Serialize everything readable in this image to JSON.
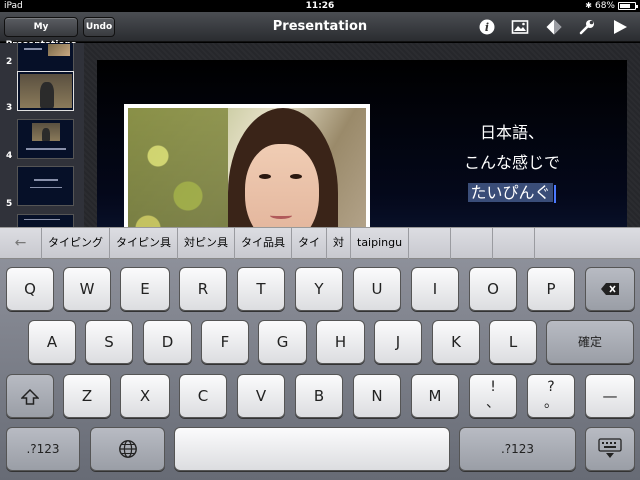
{
  "status": {
    "device": "iPad",
    "time": "11:26",
    "battery_text": "68%",
    "battery_level": 0.68
  },
  "toolbar": {
    "my_presentations": "My Presentations",
    "undo": "Undo",
    "title": "Presentation"
  },
  "navigator": {
    "slide_numbers": [
      "2",
      "3",
      "4",
      "5"
    ]
  },
  "slide": {
    "text_line1": "日本語、",
    "text_line2": "こんな感じで",
    "text_line3": "たいぴんぐ"
  },
  "candidates": [
    "タイピング",
    "タイピン具",
    "対ピン具",
    "タイ品具",
    "タイ",
    "対",
    "taipingu"
  ],
  "keyboard": {
    "row1": [
      "Q",
      "W",
      "E",
      "R",
      "T",
      "Y",
      "U",
      "I",
      "O",
      "P"
    ],
    "row2": [
      "A",
      "S",
      "D",
      "F",
      "G",
      "H",
      "J",
      "K",
      "L"
    ],
    "row3": [
      "Z",
      "X",
      "C",
      "V",
      "B",
      "N",
      "M"
    ],
    "confirm": "確定",
    "exclam_top": "!",
    "exclam_bottom": "、",
    "question_top": "?",
    "question_bottom": "。",
    "dash": "—",
    "num_left": ".?123",
    "num_right": ".?123"
  }
}
